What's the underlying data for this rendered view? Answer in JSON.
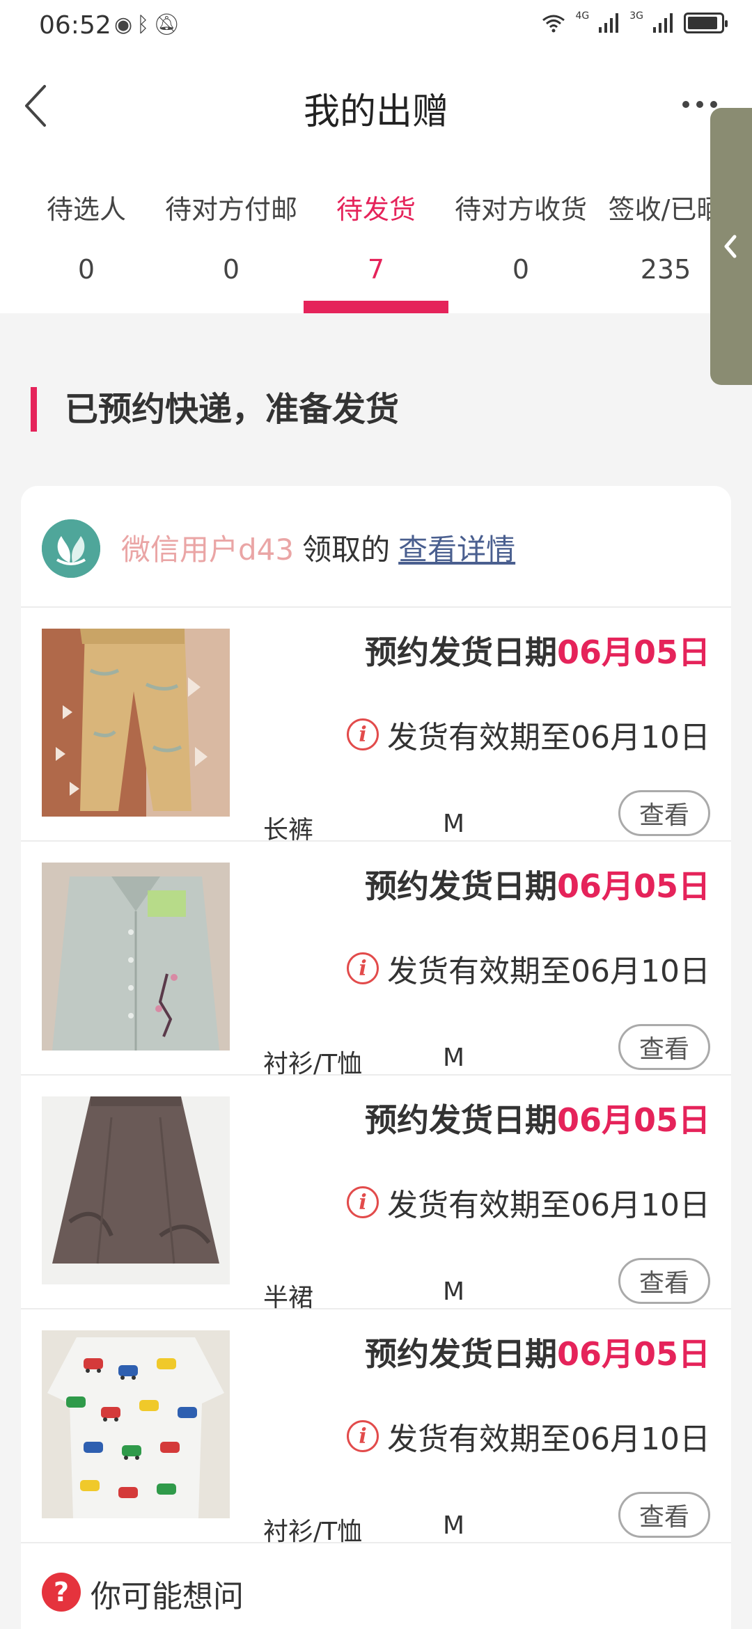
{
  "status_bar": {
    "time": "06:52",
    "left_icons": [
      "eye-icon",
      "bluetooth-icon",
      "mute-bell-icon"
    ],
    "net_labels": [
      "4G",
      "3G"
    ]
  },
  "header": {
    "title": "我的出赠"
  },
  "tabs": [
    {
      "label": "待选人",
      "count": "0"
    },
    {
      "label": "待对方付邮",
      "count": "0"
    },
    {
      "label": "待发货",
      "count": "7"
    },
    {
      "label": "待对方收货",
      "count": "0"
    },
    {
      "label": "签收/已晒",
      "count": "235"
    }
  ],
  "active_tab_index": 2,
  "section": {
    "title": "已预约快递，准备发货"
  },
  "card": {
    "receiver_name": "微信用户d43",
    "receiver_verb": "领取的",
    "detail_link": "查看详情",
    "items": [
      {
        "ship_label": "预约发货日期",
        "ship_date": "06月05日",
        "valid_text": "发货有效期至06月10日",
        "name": "长裤",
        "size": "M",
        "button": "查看"
      },
      {
        "ship_label": "预约发货日期",
        "ship_date": "06月05日",
        "valid_text": "发货有效期至06月10日",
        "name": "衬衫/T恤",
        "size": "M",
        "button": "查看"
      },
      {
        "ship_label": "预约发货日期",
        "ship_date": "06月05日",
        "valid_text": "发货有效期至06月10日",
        "name": "半裙",
        "size": "M",
        "button": "查看"
      },
      {
        "ship_label": "预约发货日期",
        "ship_date": "06月05日",
        "valid_text": "发货有效期至06月10日",
        "name": "衬衫/T恤",
        "size": "M",
        "button": "查看"
      }
    ],
    "faq": {
      "label": "你可能想问"
    }
  },
  "colors": {
    "accent": "#e5235a",
    "link": "#4a5f8f",
    "receiver": "#eaa5a5"
  }
}
